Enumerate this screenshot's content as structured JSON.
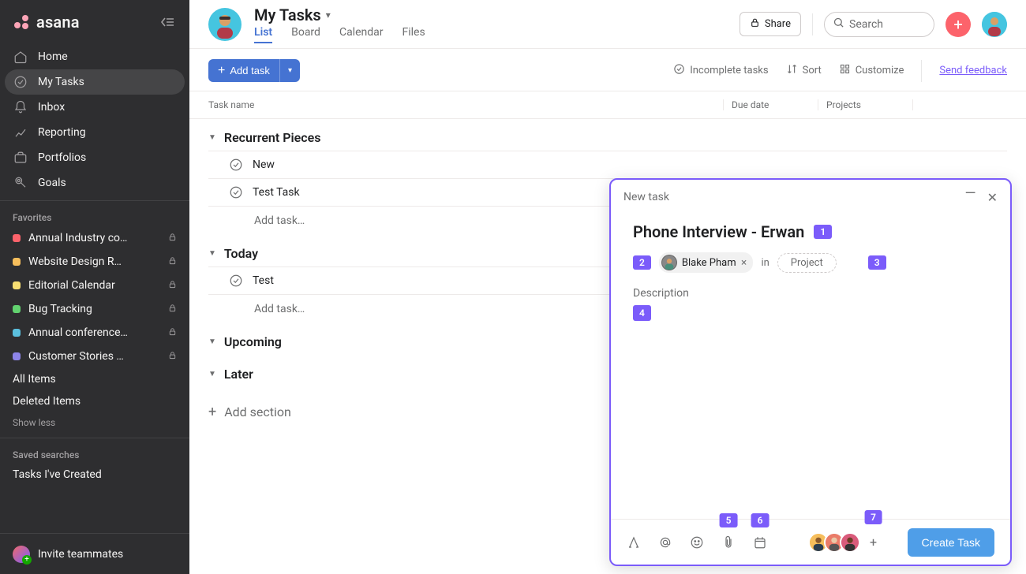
{
  "app": {
    "name": "asana"
  },
  "sidebar": {
    "nav": [
      {
        "label": "Home",
        "active": false
      },
      {
        "label": "My Tasks",
        "active": true
      },
      {
        "label": "Inbox",
        "active": false
      },
      {
        "label": "Reporting",
        "active": false
      },
      {
        "label": "Portfolios",
        "active": false
      },
      {
        "label": "Goals",
        "active": false
      }
    ],
    "favorites_title": "Favorites",
    "favorites": [
      {
        "label": "Annual Industry co…",
        "color": "#fc636b",
        "locked": true
      },
      {
        "label": "Website Design R…",
        "color": "#f6be5c",
        "locked": true
      },
      {
        "label": "Editorial Calendar",
        "color": "#f8df72",
        "locked": true
      },
      {
        "label": "Bug Tracking",
        "color": "#62d26f",
        "locked": true
      },
      {
        "label": "Annual conference…",
        "color": "#5bc0de",
        "locked": true
      },
      {
        "label": "Customer Stories …",
        "color": "#8d84e8",
        "locked": true
      }
    ],
    "all_items": "All Items",
    "deleted_items": "Deleted Items",
    "show_less": "Show less",
    "saved_title": "Saved searches",
    "saved": [
      "Tasks I've Created"
    ],
    "invite": "Invite teammates"
  },
  "header": {
    "title": "My Tasks",
    "tabs": [
      {
        "label": "List",
        "active": true
      },
      {
        "label": "Board",
        "active": false
      },
      {
        "label": "Calendar",
        "active": false
      },
      {
        "label": "Files",
        "active": false
      }
    ],
    "share": "Share",
    "search_placeholder": "Search"
  },
  "toolbar": {
    "add_task": "Add task",
    "incomplete": "Incomplete tasks",
    "sort": "Sort",
    "customize": "Customize",
    "feedback": "Send feedback"
  },
  "columns": {
    "c1": "Task name",
    "c2": "Due date",
    "c3": "Projects"
  },
  "sections": [
    {
      "name": "Recurrent Pieces",
      "rows": [
        "New",
        "Test Task"
      ],
      "add": "Add task…"
    },
    {
      "name": "Today",
      "rows": [
        "Test"
      ],
      "add": "Add task…"
    },
    {
      "name": "Upcoming",
      "rows": [],
      "add": null
    },
    {
      "name": "Later",
      "rows": [],
      "add": null
    }
  ],
  "add_section": "Add section",
  "modal": {
    "badges": [
      "1",
      "2",
      "3",
      "4",
      "5",
      "6",
      "7"
    ],
    "title": "New task",
    "task_name": "Phone Interview - Erwan",
    "assignee": "Blake Pham",
    "in": "in",
    "project_placeholder": "Project",
    "description_label": "Description",
    "create": "Create Task"
  }
}
